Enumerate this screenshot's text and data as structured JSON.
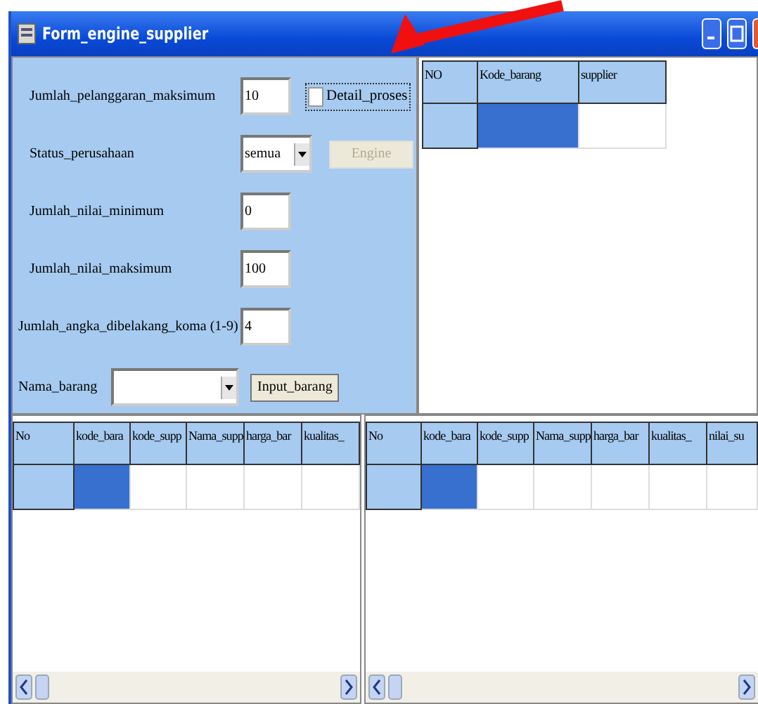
{
  "window": {
    "title": "Form_engine_supplier"
  },
  "form": {
    "rows": [
      {
        "kind": "text",
        "label": "Jumlah_pelanggaran_maksimum",
        "value": "10"
      },
      {
        "kind": "select",
        "label": "Status_perusahaan",
        "value": "semua"
      },
      {
        "kind": "text",
        "label": "Jumlah_nilai_minimum",
        "value": "0"
      },
      {
        "kind": "text",
        "label": "Jumlah_nilai_maksimum",
        "value": "100"
      },
      {
        "kind": "text",
        "label": "Jumlah_angka_dibelakang_koma (1-9)",
        "value": "4"
      }
    ],
    "detail_checkbox": {
      "label": "Detail_proses",
      "checked": false,
      "focused": true
    },
    "engine_button": {
      "label": "Engine",
      "disabled": true
    },
    "nama_barang": {
      "label": "Nama_barang"
    },
    "input_button": {
      "label": "Input_barang",
      "disabled": false
    }
  },
  "grids": [
    {
      "columns": [
        "NO",
        "Kode_barang",
        "supplier"
      ],
      "rows": [
        {
          "cells": [
            {
              "selected": false
            },
            {
              "selected": true
            },
            {
              "selected": false
            }
          ]
        }
      ]
    },
    {
      "columns": [
        "No",
        "kode_bara",
        "kode_supp",
        "Nama_supp",
        "harga_bar",
        "kualitas_"
      ],
      "rows": [
        {
          "cells": [
            {
              "selected": false
            },
            {
              "selected": true
            },
            {
              "selected": false
            },
            {
              "selected": false
            },
            {
              "selected": false
            },
            {
              "selected": false
            }
          ]
        }
      ]
    },
    {
      "columns": [
        "No",
        "kode_bara",
        "kode_supp",
        "Nama_supp",
        "harga_bar",
        "kualitas_",
        "nilai_su"
      ],
      "rows": [
        {
          "cells": [
            {
              "selected": false
            },
            {
              "selected": true
            },
            {
              "selected": false
            },
            {
              "selected": false
            },
            {
              "selected": false
            },
            {
              "selected": false
            },
            {
              "selected": false
            }
          ]
        }
      ]
    }
  ]
}
